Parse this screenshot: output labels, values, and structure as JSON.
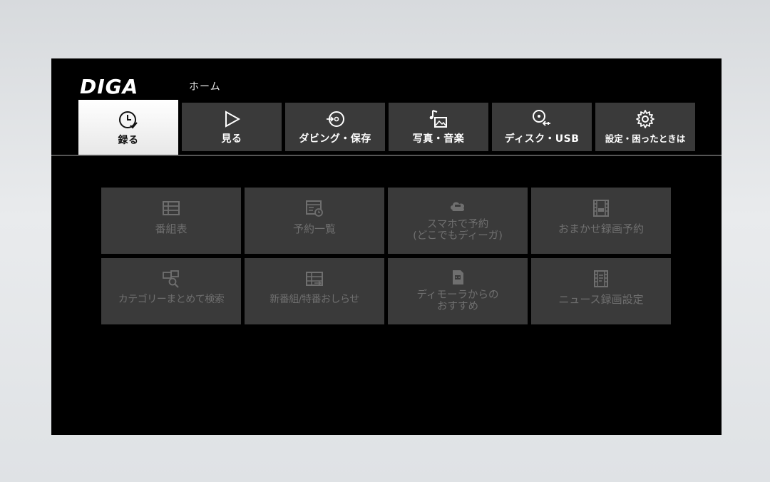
{
  "brand": {
    "logo_text": "DIGA"
  },
  "breadcrumb": {
    "text": "ホーム"
  },
  "tabs": [
    {
      "label": "録る",
      "icon": "clock-record-icon",
      "active": true
    },
    {
      "label": "見る",
      "icon": "play-icon",
      "active": false
    },
    {
      "label": "ダビング・保存",
      "icon": "dubbing-disc-icon",
      "active": false
    },
    {
      "label": "写真・音楽",
      "icon": "photo-music-icon",
      "active": false
    },
    {
      "label": "ディスク・USB",
      "icon": "disc-usb-icon",
      "active": false
    },
    {
      "label": "設定・困ったときは",
      "icon": "gear-icon",
      "active": false
    }
  ],
  "menu": {
    "items": [
      {
        "line1": "番組表",
        "line2": "",
        "icon": "program-guide-icon"
      },
      {
        "line1": "予約一覧",
        "line2": "",
        "icon": "reservation-list-icon"
      },
      {
        "line1": "スマホで予約",
        "line2": "(どこでもディーガ)",
        "icon": "smartphone-cloud-icon"
      },
      {
        "line1": "おまかせ録画予約",
        "line2": "",
        "icon": "auto-record-film-icon"
      },
      {
        "line1": "カテゴリーまとめて検索",
        "line2": "",
        "icon": "category-search-icon"
      },
      {
        "line1": "新番組/特番おしらせ",
        "line2": "",
        "icon": "new-program-icon"
      },
      {
        "line1": "ディモーラからの",
        "line2": "おすすめ",
        "icon": "dimora-recommend-icon"
      },
      {
        "line1": "ニュース録画設定",
        "line2": "",
        "icon": "news-record-icon"
      }
    ]
  },
  "colors": {
    "screen_bg": "#000000",
    "tab_bg": "#3a3a3a",
    "tab_active_bg": "#ffffff",
    "tile_bg": "#3a3a3a",
    "tile_text": "#6f6f6f",
    "bezel": "#e3e5e8"
  }
}
